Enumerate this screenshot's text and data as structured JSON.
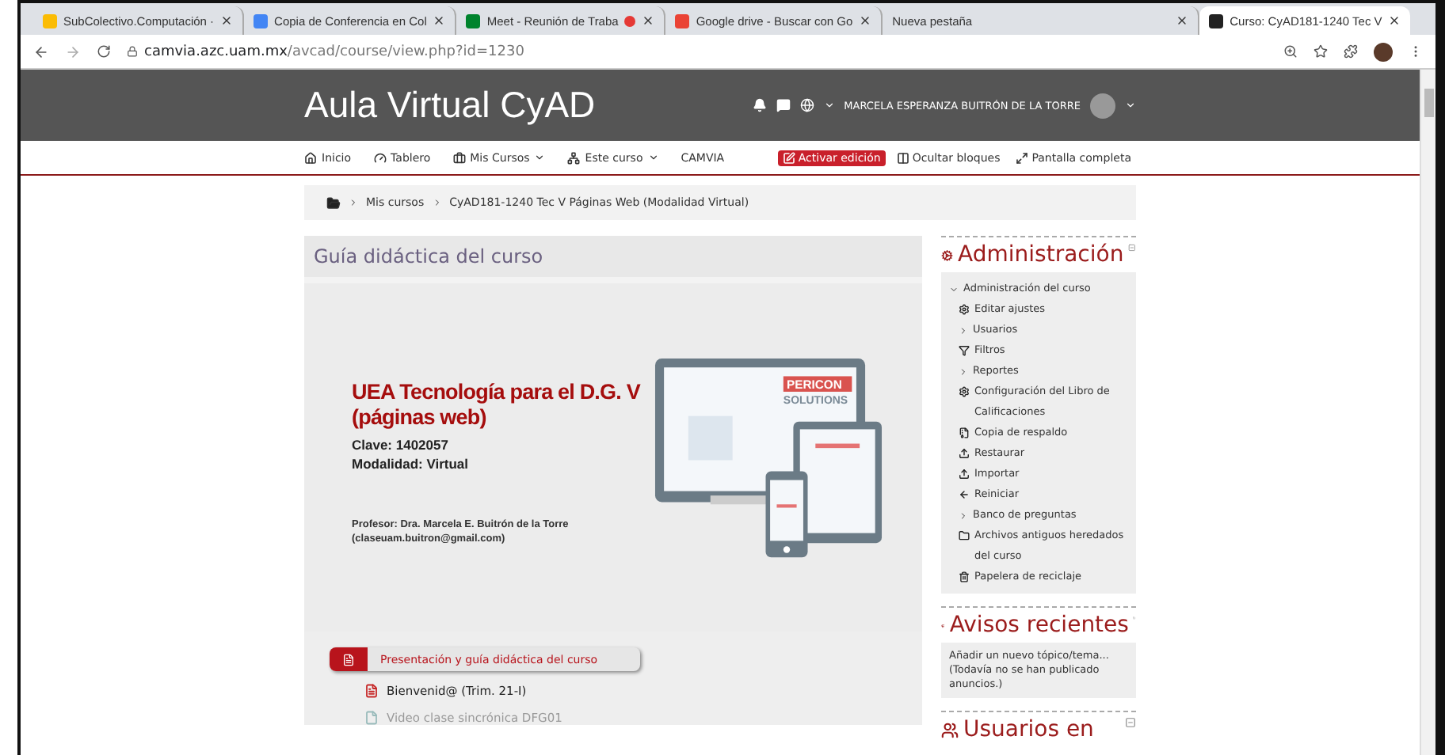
{
  "browser": {
    "tabs": [
      {
        "title": "SubColectivo.Computación ·",
        "recording": false,
        "selected": false
      },
      {
        "title": "Copia de Conferencia en Col",
        "recording": false,
        "selected": false
      },
      {
        "title": "Meet - Reunión de Traba",
        "recording": true,
        "selected": false
      },
      {
        "title": "Google drive - Buscar con Go",
        "recording": false,
        "selected": false
      },
      {
        "title": "Nueva pestaña",
        "recording": false,
        "selected": false
      },
      {
        "title": "Curso: CyAD181-1240 Tec V",
        "recording": false,
        "selected": true
      }
    ],
    "url_host": "camvia.azc.uam.mx",
    "url_path": "/avcad/course/view.php?id=1230"
  },
  "header": {
    "site_name": "Aula Virtual CyAD",
    "user_name": "MARCELA ESPERANZA BUITRÓN DE LA TORRE"
  },
  "nav": {
    "items": [
      {
        "label": "Inicio",
        "dropdown": false
      },
      {
        "label": "Tablero",
        "dropdown": false
      },
      {
        "label": "Mis Cursos",
        "dropdown": true
      },
      {
        "label": "Este curso",
        "dropdown": true
      },
      {
        "label": "CAMVIA",
        "dropdown": false
      }
    ],
    "actions": [
      {
        "label": "Activar edición",
        "kind": "primary"
      },
      {
        "label": "Ocultar bloques",
        "kind": "plain"
      },
      {
        "label": "Pantalla completa",
        "kind": "plain"
      }
    ]
  },
  "breadcrumb": [
    "Mis cursos",
    "CyAD181-1240 Tec V Páginas Web (Modalidad Virtual)"
  ],
  "section": {
    "title": "Guía didáctica del curso",
    "banner": {
      "title_lines": [
        "UEA Tecnología para el D.G. V",
        "(páginas web)"
      ],
      "details": [
        "Clave: 1402057",
        "Modalidad: Virtual"
      ],
      "teacher": [
        "Profesor: Dra. Marcela E. Buitrón de la Torre",
        "(claseuam.buitron@gmail.com)"
      ],
      "brand": [
        "PERICON",
        "SOLUTIONS"
      ]
    },
    "label": "Presentación y guía didáctica del curso",
    "activities": [
      {
        "label": "Bienvenid@ (Trim. 21-I)",
        "dimmed": false
      },
      {
        "label": "Video clase sincrónica DFG01",
        "dimmed": true
      }
    ]
  },
  "blocks": [
    {
      "title": "Administración",
      "tree": [
        {
          "label": "Administración del curso",
          "expanded": true,
          "children": [
            {
              "label": "Editar ajustes",
              "kind": "link"
            },
            {
              "label": "Usuarios",
              "kind": "branch",
              "expanded": false
            },
            {
              "label": "Filtros",
              "kind": "link"
            },
            {
              "label": "Reportes",
              "kind": "branch",
              "expanded": false
            },
            {
              "label": "Configuración del Libro de Calificaciones",
              "kind": "link"
            },
            {
              "label": "Copia de respaldo",
              "kind": "link"
            },
            {
              "label": "Restaurar",
              "kind": "link"
            },
            {
              "label": "Importar",
              "kind": "link"
            },
            {
              "label": "Reiniciar",
              "kind": "link"
            },
            {
              "label": "Banco de preguntas",
              "kind": "branch",
              "expanded": false
            },
            {
              "label": "Archivos antiguos heredados del curso",
              "kind": "link"
            },
            {
              "label": "Papelera de reciclaje",
              "kind": "link"
            }
          ]
        }
      ]
    },
    {
      "title": "Avisos recientes",
      "lines": [
        "Añadir un nuevo tópico/tema...",
        "(Todavía no se han publicado anuncios.)"
      ]
    },
    {
      "title": "Usuarios en"
    }
  ]
}
